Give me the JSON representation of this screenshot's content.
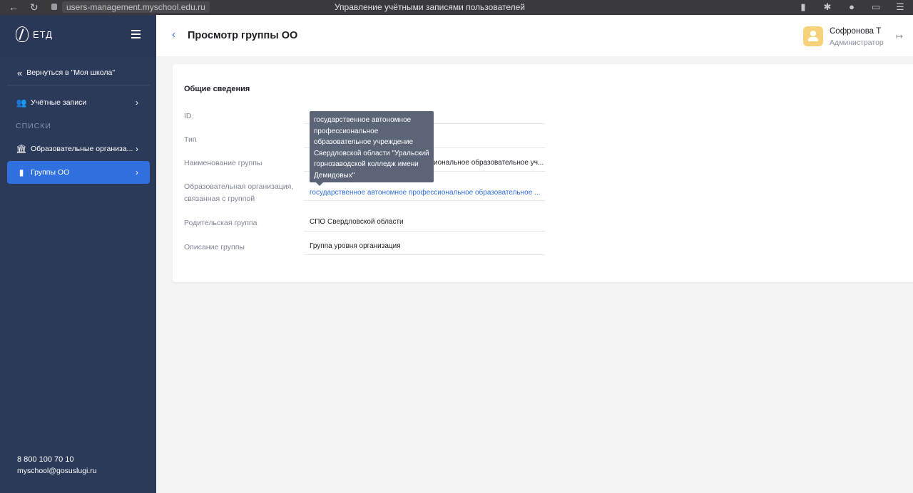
{
  "browser": {
    "url": "users-management.myschool.edu.ru",
    "window_title": "Управление учётными записями пользователей",
    "back_icon": "←",
    "reload_icon": "↻"
  },
  "sidebar": {
    "logo_text": "ЕТД",
    "back_link": "Вернуться в \"Моя школа\"",
    "items": [
      {
        "label": "Учётные записи",
        "icon": "users-icon"
      },
      {
        "label": "Образовательные организа...",
        "icon": "building-icon"
      },
      {
        "label": "Группы ОО",
        "icon": "bookmark-icon",
        "active": true
      }
    ],
    "section_label": "СПИСКИ",
    "footer": {
      "phone": "8 800 100 70 10",
      "email": "myschool@gosuslugi.ru"
    }
  },
  "header": {
    "title": "Просмотр группы ОО",
    "user_name": "Софронова Т",
    "user_role": "Администратор"
  },
  "card": {
    "section_title": "Общие сведения",
    "fields": [
      {
        "label": "ID",
        "value": ""
      },
      {
        "label": "Тип",
        "value": ""
      },
      {
        "label": "Наименование группы",
        "value": "иональное образовательное уч..."
      },
      {
        "label": "Образовательная организация, связанная с группой",
        "value": "государственное автономное профессиональное образовательное ..."
      },
      {
        "label": "Родительская группа",
        "value": "СПО Свердловской области"
      },
      {
        "label": "Описание группы",
        "value": "Группа уровня организация"
      }
    ]
  },
  "tooltip": {
    "text": "государственное автономное профессиональное образовательное учреждение Свердловской области \"Уральский горнозаводской колледж имени Демидовых\""
  },
  "colors": {
    "sidebar_bg": "#2c3a59",
    "accent": "#2f6fde",
    "tooltip_bg": "#5b6577"
  }
}
